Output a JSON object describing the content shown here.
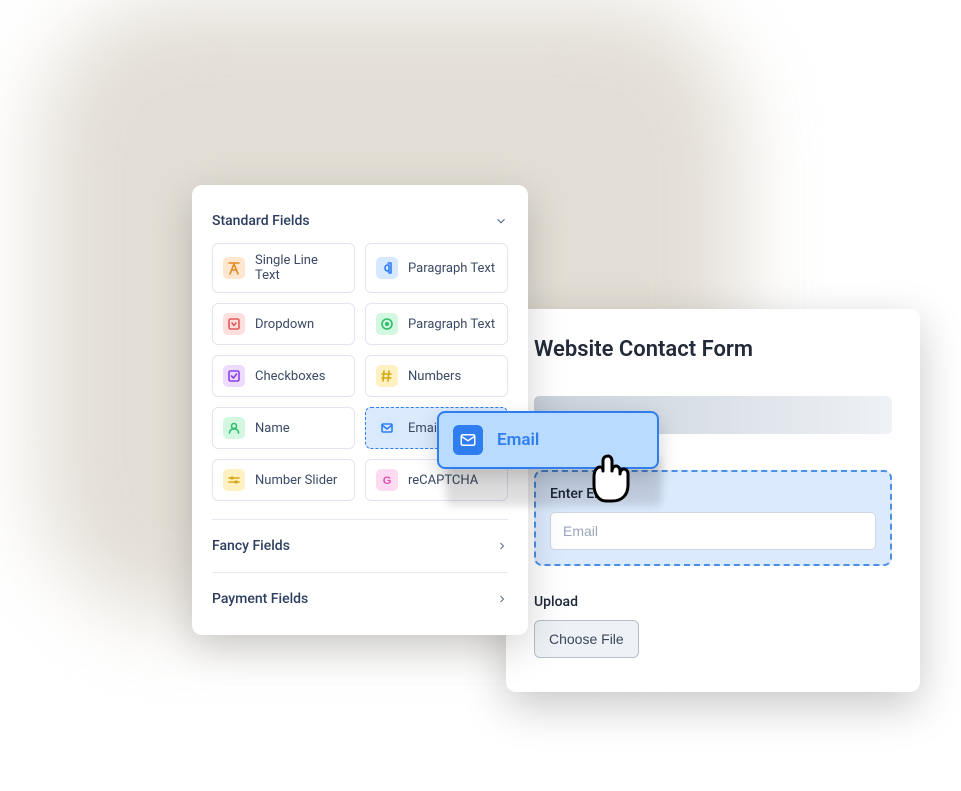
{
  "fields_panel": {
    "sections": {
      "standard": {
        "title": "Standard Fields",
        "items": [
          {
            "label": "Single Line Text",
            "icon": "text-a",
            "bg": "#ffe6ce",
            "fg": "#e08a1f"
          },
          {
            "label": "Paragraph Text",
            "icon": "paragraph",
            "bg": "#d7e9ff",
            "fg": "#2f7ef0"
          },
          {
            "label": "Dropdown",
            "icon": "dropdown",
            "bg": "#ffdede",
            "fg": "#e05a5a"
          },
          {
            "label": "Paragraph Text",
            "icon": "radio",
            "bg": "#d3f7e0",
            "fg": "#2fbf6a"
          },
          {
            "label": "Checkboxes",
            "icon": "checkbox",
            "bg": "#ecdcff",
            "fg": "#8a3ff0"
          },
          {
            "label": "Numbers",
            "icon": "hash",
            "bg": "#fff1c2",
            "fg": "#d6a80f"
          },
          {
            "label": "Name",
            "icon": "person",
            "bg": "#d3f7e0",
            "fg": "#2fbf6a"
          },
          {
            "label": "Email",
            "icon": "mail",
            "bg": "#d7e9ff",
            "fg": "#2f7ef0",
            "selected": true
          },
          {
            "label": "Number Slider",
            "icon": "slider",
            "bg": "#fff1c2",
            "fg": "#d6a80f"
          },
          {
            "label": "reCAPTCHA",
            "icon": "g",
            "bg": "#ffdbf2",
            "fg": "#e04fb0"
          }
        ]
      },
      "fancy": {
        "title": "Fancy Fields"
      },
      "payment": {
        "title": "Payment Fields"
      }
    }
  },
  "drag_chip": {
    "label": "Email"
  },
  "form_preview": {
    "title": "Website Contact Form",
    "email_label": "Enter Email",
    "email_placeholder": "Email",
    "upload_label": "Upload",
    "choose_file_label": "Choose File"
  }
}
